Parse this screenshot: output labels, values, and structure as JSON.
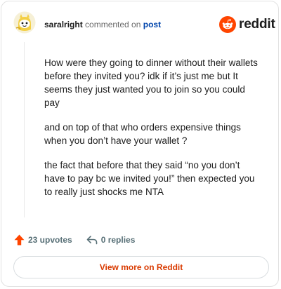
{
  "comment": {
    "username": "saralright",
    "action_text": "commented on",
    "post_link": "post",
    "paragraphs": [
      "How were they going to dinner without their wallets before they invited you? idk if it’s just me but It seems they just wanted you to join so you could pay",
      "and on top of that who orders expensive things when you don’t have your wallet ?",
      "the fact that before that they said “no you don’t have to pay bc we invited you!” then expected you to really just shocks me NTA"
    ],
    "upvotes_label": "23 upvotes",
    "replies_label": "0 replies"
  },
  "brand": {
    "wordmark": "reddit",
    "accent_color": "#ff4500"
  },
  "footer": {
    "view_more_label": "View more on Reddit"
  },
  "icons": {
    "avatar": "snoo-avatar-icon",
    "logo": "reddit-logo-icon",
    "upvote": "upvote-arrow-icon",
    "reply": "reply-arrow-icon"
  }
}
